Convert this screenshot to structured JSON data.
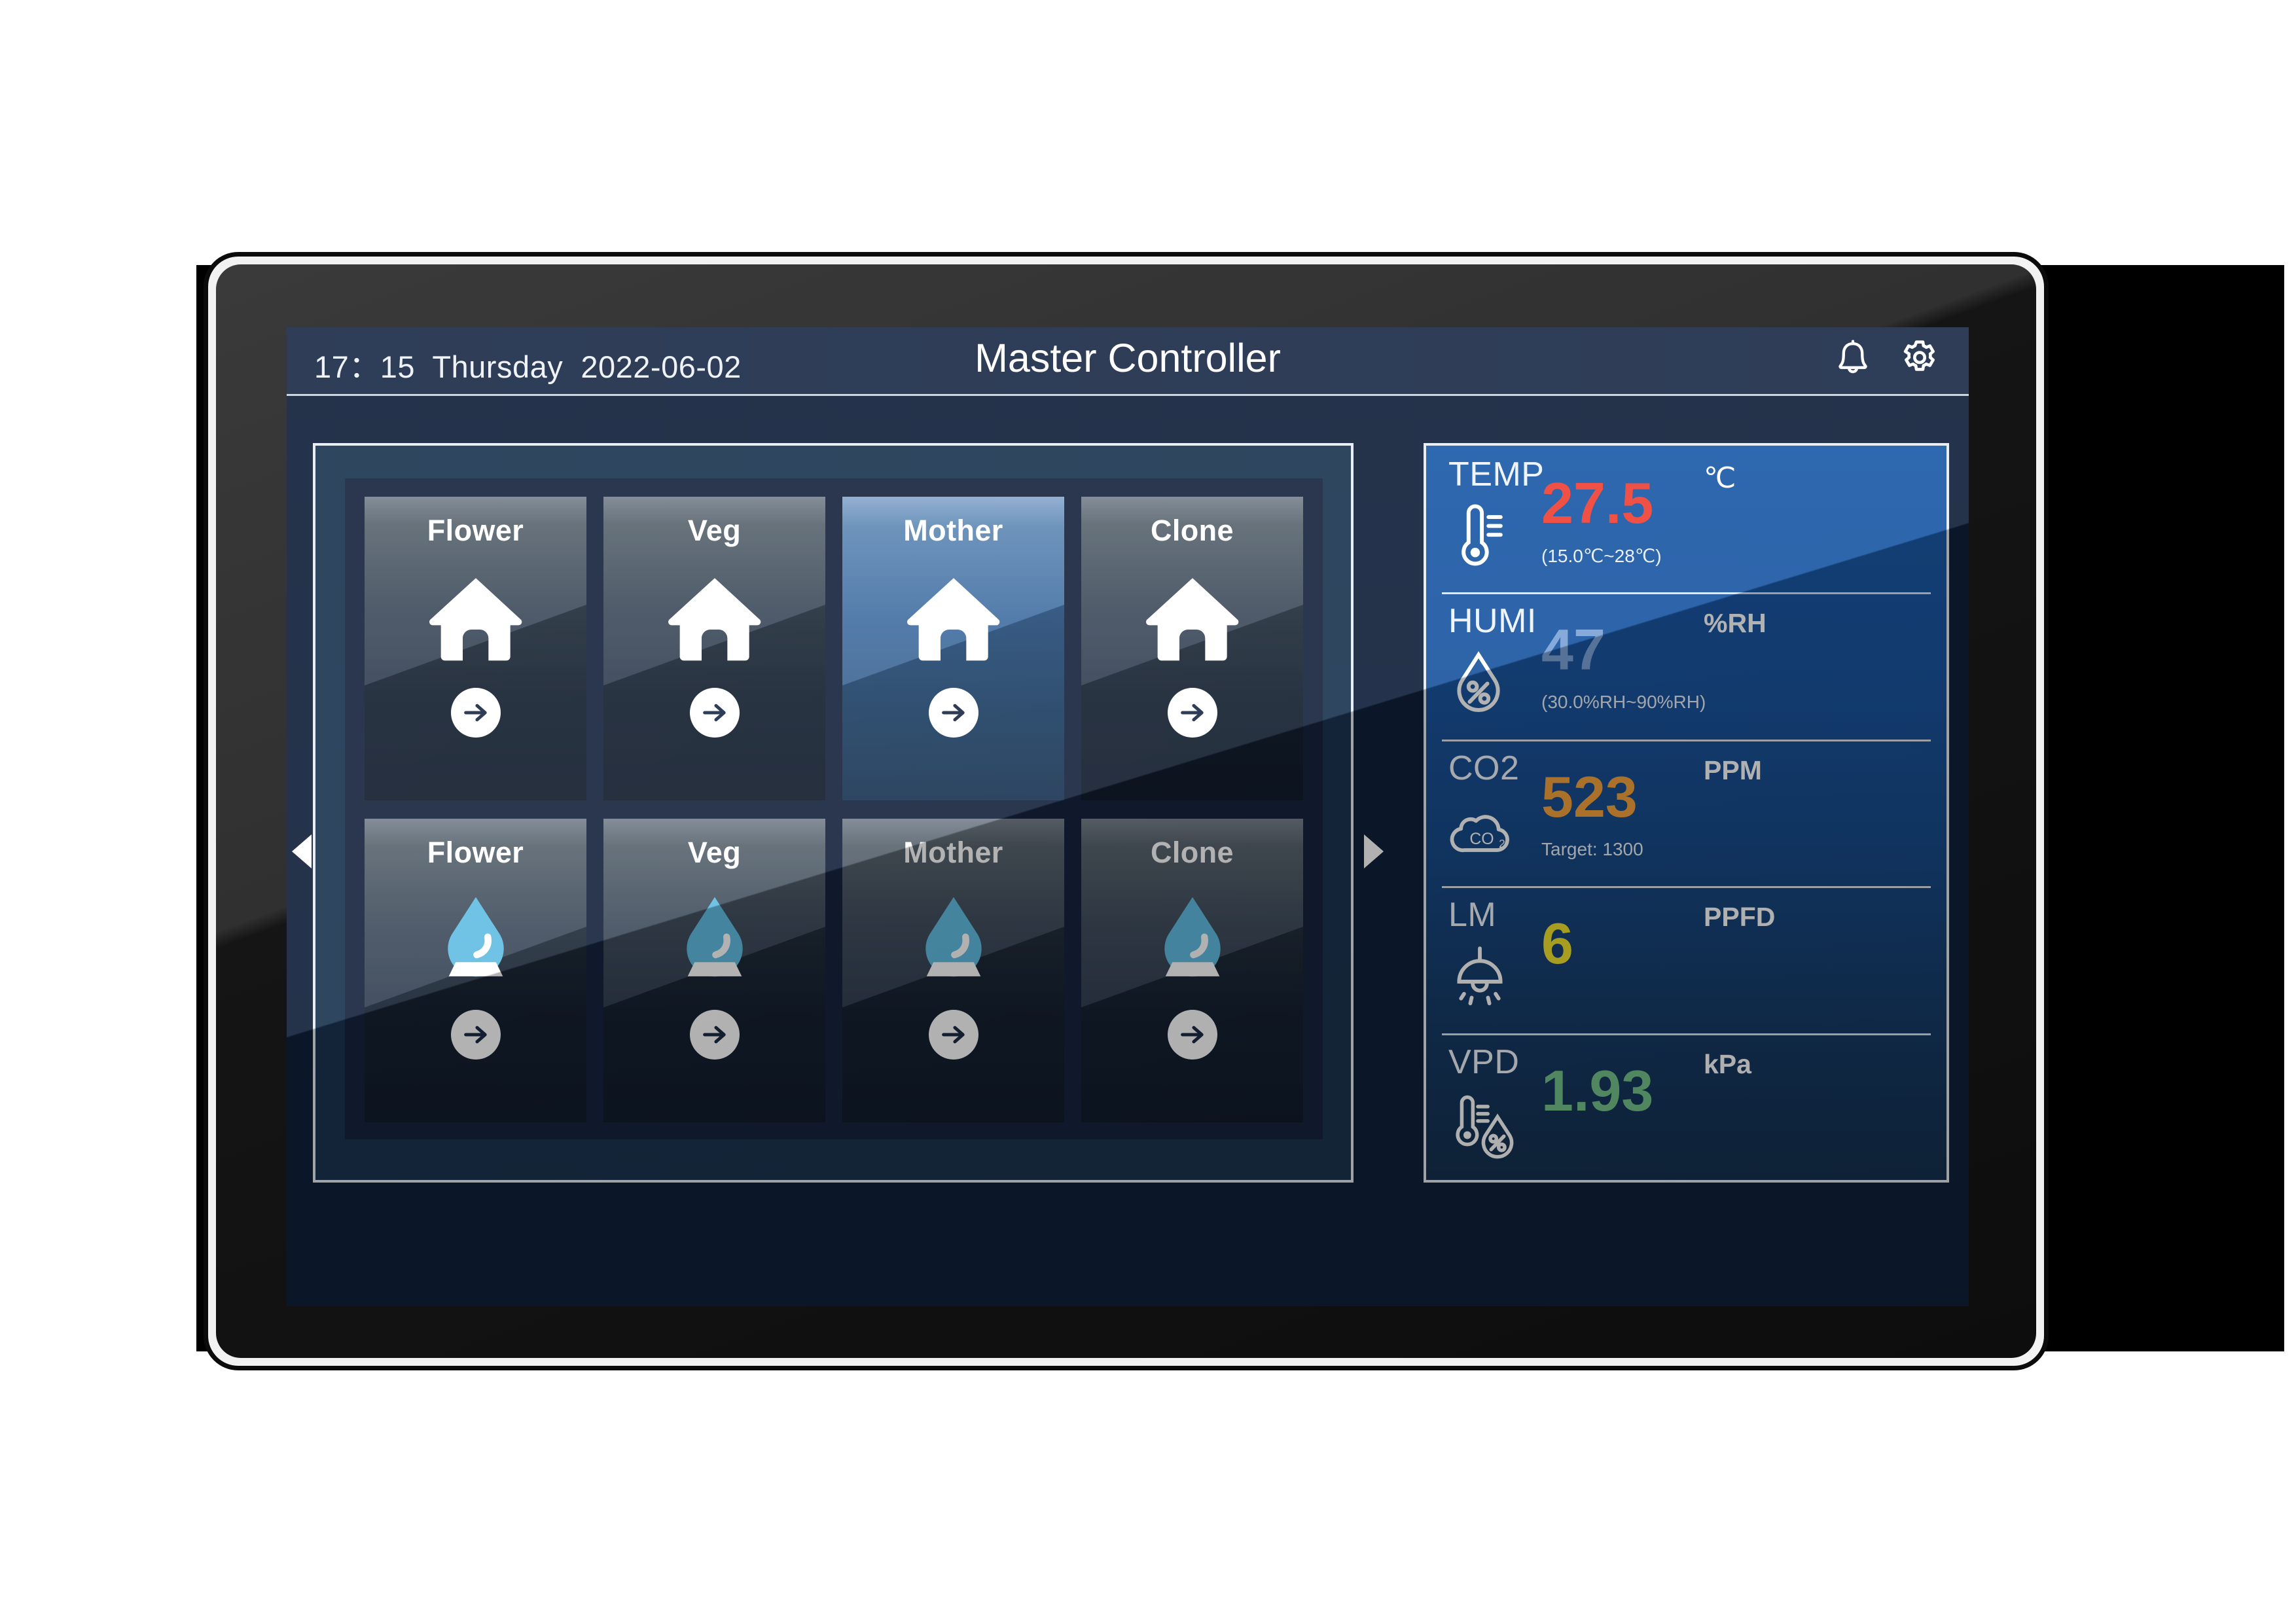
{
  "header": {
    "time": "17：15",
    "weekday": "Thursday",
    "date": "2022-06-02",
    "datetime_display": "17：15  Thursday  2022-06-02",
    "title": "Master Controller",
    "bell_icon": "bell-icon",
    "gear_icon": "gear-icon"
  },
  "carousel": {
    "prev_icon": "triangle-left-icon",
    "next_icon": "triangle-right-icon"
  },
  "rooms": {
    "row_climate": [
      {
        "label": "Flower",
        "icon": "house-icon",
        "selected": false,
        "arrow": "arrow-right-icon"
      },
      {
        "label": "Veg",
        "icon": "house-icon",
        "selected": false,
        "arrow": "arrow-right-icon"
      },
      {
        "label": "Mother",
        "icon": "house-icon",
        "selected": true,
        "arrow": "arrow-right-icon"
      },
      {
        "label": "Clone",
        "icon": "house-icon",
        "selected": false,
        "arrow": "arrow-right-icon"
      }
    ],
    "row_irrigation": [
      {
        "label": "Flower",
        "icon": "water-drop-icon",
        "selected": false,
        "arrow": "arrow-right-icon"
      },
      {
        "label": "Veg",
        "icon": "water-drop-icon",
        "selected": false,
        "arrow": "arrow-right-icon"
      },
      {
        "label": "Mother",
        "icon": "water-drop-icon",
        "selected": false,
        "arrow": "arrow-right-icon"
      },
      {
        "label": "Clone",
        "icon": "water-drop-icon",
        "selected": false,
        "arrow": "arrow-right-icon"
      }
    ]
  },
  "sensors": [
    {
      "name": "TEMP",
      "value": "27.5",
      "unit": "℃",
      "sub": "(15.0℃~28℃)",
      "color": "#ef4136",
      "icon": "thermometer-icon"
    },
    {
      "name": "HUMI",
      "value": "47",
      "unit": "%RH",
      "sub": "(30.0%RH~90%RH)",
      "color": "#7ba3d8",
      "icon": "humidity-drop-icon"
    },
    {
      "name": "CO2",
      "value": "523",
      "unit": "PPM",
      "sub": "Target:  1300",
      "color": "#f5a33c",
      "icon": "co2-cloud-icon"
    },
    {
      "name": "LM",
      "value": "6",
      "unit": "PPFD",
      "sub": "",
      "color": "#f2e330",
      "icon": "lamp-icon"
    },
    {
      "name": "VPD",
      "value": "1.93",
      "unit": "kPa",
      "sub": "",
      "color": "#74c48b",
      "icon": "vpd-icon"
    }
  ],
  "colors": {
    "screen_bg": "#10203a",
    "header_bg": "#1b2b47",
    "panel_border": "#e6ecf3",
    "rooms_panel_bg": "#1b3450",
    "rooms_inner_bg": "#16243e",
    "sensor_panel_top": "#1a5aa8",
    "sensor_panel_bottom": "#15304f",
    "tile_selected": "#2f6099",
    "drop_blue": "#62bde2"
  }
}
